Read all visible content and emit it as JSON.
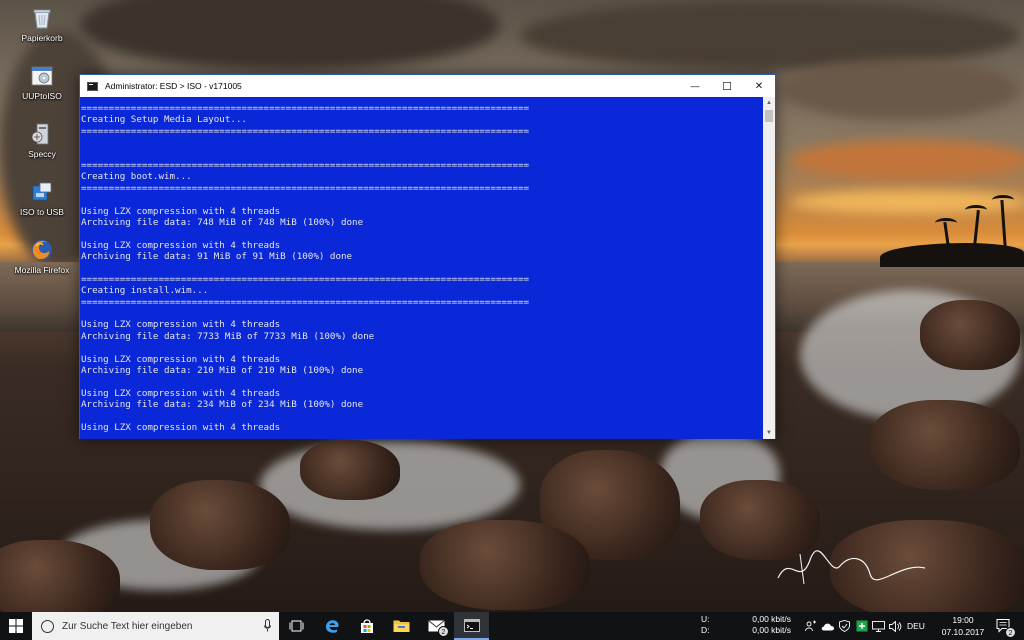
{
  "desktop_icons": [
    {
      "label": "Papierkorb",
      "icon": "recycle-bin-icon"
    },
    {
      "label": "UUPtoISO",
      "icon": "uuptoiso-app-icon"
    },
    {
      "label": "Speccy",
      "icon": "speccy-app-icon"
    },
    {
      "label": "ISO to USB",
      "icon": "iso-to-usb-app-icon"
    },
    {
      "label": "Mozilla Firefox",
      "icon": "firefox-icon"
    }
  ],
  "window": {
    "title": "Administrator:  ESD > ISO - v171005",
    "minimize_glyph": "—",
    "maximize_glyph": "☐",
    "close_glyph": "✕",
    "console_lines": [
      "=================================================================================",
      "Creating Setup Media Layout...",
      "=================================================================================",
      "",
      "",
      "=================================================================================",
      "Creating boot.wim...",
      "=================================================================================",
      "",
      "Using LZX compression with 4 threads",
      "Archiving file data: 748 MiB of 748 MiB (100%) done",
      "",
      "Using LZX compression with 4 threads",
      "Archiving file data: 91 MiB of 91 MiB (100%) done",
      "",
      "=================================================================================",
      "Creating install.wim...",
      "=================================================================================",
      "",
      "Using LZX compression with 4 threads",
      "Archiving file data: 7733 MiB of 7733 MiB (100%) done",
      "",
      "Using LZX compression with 4 threads",
      "Archiving file data: 210 MiB of 210 MiB (100%) done",
      "",
      "Using LZX compression with 4 threads",
      "Archiving file data: 234 MiB of 234 MiB (100%) done",
      "",
      "Using LZX compression with 4 threads"
    ],
    "console_bg": "#0a28d8",
    "console_fg": "#e6e6e6"
  },
  "taskbar": {
    "search_placeholder": "Zur Suche Text hier eingeben",
    "apps": [
      {
        "name": "task-view",
        "icon": "task-view-icon"
      },
      {
        "name": "edge",
        "icon": "edge-icon"
      },
      {
        "name": "store",
        "icon": "store-icon"
      },
      {
        "name": "file-explorer",
        "icon": "folder-icon"
      },
      {
        "name": "mail",
        "icon": "mail-icon",
        "badge": "2"
      },
      {
        "name": "console",
        "icon": "console-icon",
        "active": true
      }
    ],
    "net_upload_label": "U:",
    "net_upload_value": "0,00 kbit/s",
    "net_download_label": "D:",
    "net_download_value": "0,00 kbit/s",
    "language": "DEU",
    "time": "19:00",
    "date": "07.10.2017",
    "notification_count": "2",
    "accent": "#7aa7ea"
  }
}
